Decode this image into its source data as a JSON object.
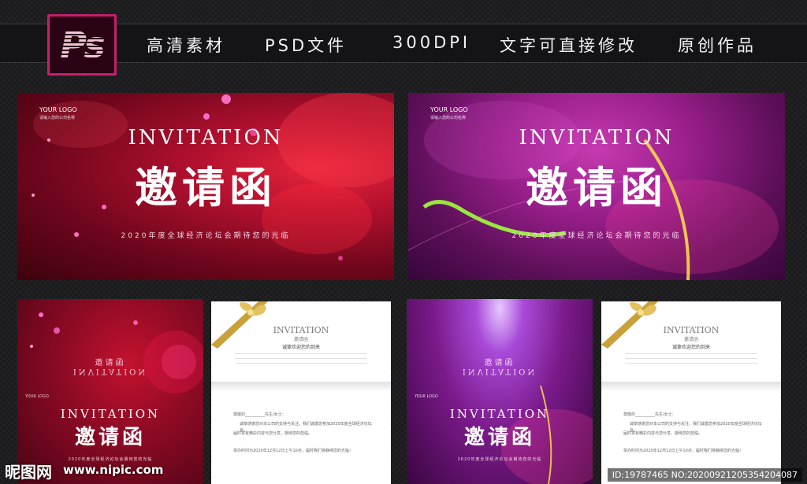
{
  "header": {
    "logo_text": "Ps",
    "features": [
      "高清素材",
      "PSD文件",
      "300DPI",
      "文字可直接修改",
      "原创作品"
    ]
  },
  "cards": {
    "main": {
      "logo": "YOUR LOGO",
      "logo_sub": "请输入您的公司名称",
      "title_en": "INVITATION",
      "title_cn": "邀请函",
      "subtitle": "2020年度全球经济论坛会期待您的光临"
    },
    "inner": {
      "title_en": "INVITATION",
      "title_cn": "邀请函",
      "header_cn": "诚挚欢迎您的到来",
      "back_title_cn": "邀请函",
      "back_title_en": "INVITATION",
      "logo": "YOUR LOGO",
      "subtitle": "2020年度全球经济论坛会期待您的光临",
      "greeting": "尊敬的__________先生/女士：",
      "body_1": "诚挚感谢您对本公司的支持与关注，我们诚邀您参加2020年度全球经济论坛会，",
      "body_2": "届时将有精彩内容与您分享，期待您的莅临。",
      "time_line": "举办时间为2020年12月12日上午10点，届时我们将静候您的光临！"
    }
  },
  "watermark": {
    "brand": "昵图网",
    "url": "www.nipic.com",
    "id_text": "ID:19787465 NO:20200921205354204087"
  },
  "colors": {
    "ps_border": "#c4206e",
    "red_card": "#8c0a2a",
    "purple_card": "#8a1a7a"
  }
}
